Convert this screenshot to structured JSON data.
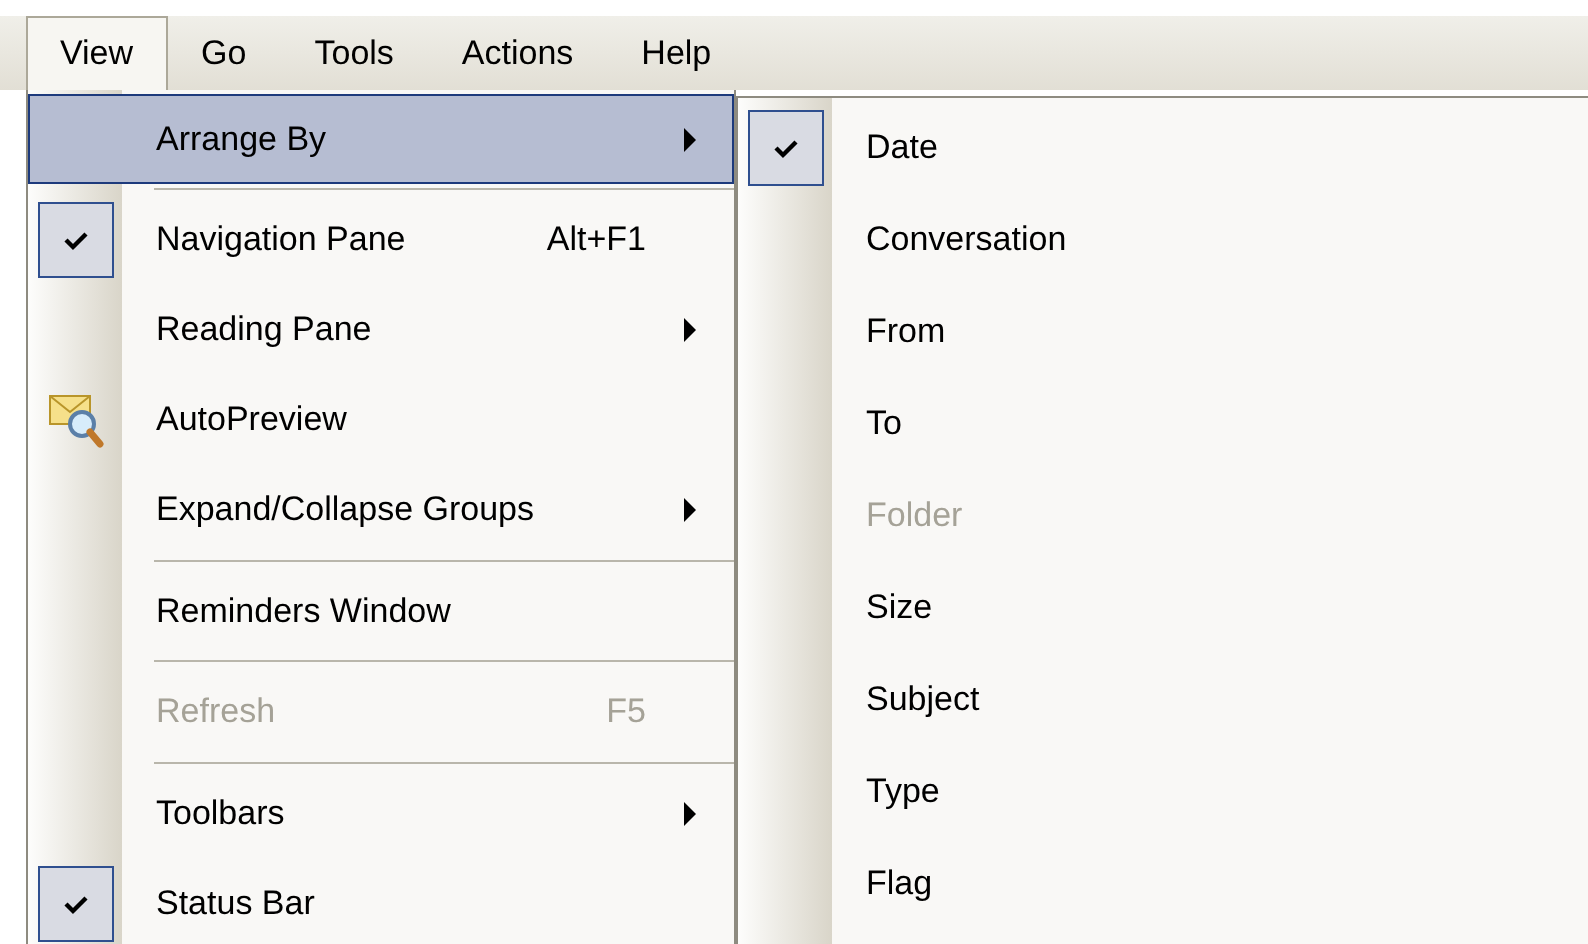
{
  "menu_bar": [
    {
      "label": "View",
      "selected": true
    },
    {
      "label": "Go",
      "selected": false
    },
    {
      "label": "Tools",
      "selected": false
    },
    {
      "label": "Actions",
      "selected": false
    },
    {
      "label": "Help",
      "selected": false
    }
  ],
  "view_menu": [
    {
      "kind": "submenu",
      "label": "Arrange By",
      "selected": true,
      "disabled": false
    },
    {
      "kind": "separator"
    },
    {
      "kind": "check",
      "label": "Navigation Pane",
      "shortcut": "Alt+F1",
      "checked": true,
      "selected": false,
      "disabled": false
    },
    {
      "kind": "submenu",
      "label": "Reading Pane",
      "selected": false,
      "disabled": false
    },
    {
      "kind": "icon",
      "label": "AutoPreview",
      "selected": false,
      "disabled": false
    },
    {
      "kind": "submenu",
      "label": "Expand/Collapse Groups",
      "selected": false,
      "disabled": false
    },
    {
      "kind": "separator"
    },
    {
      "kind": "command",
      "label": "Reminders Window",
      "selected": false,
      "disabled": false
    },
    {
      "kind": "separator"
    },
    {
      "kind": "command",
      "label": "Refresh",
      "shortcut": "F5",
      "selected": false,
      "disabled": true
    },
    {
      "kind": "separator"
    },
    {
      "kind": "submenu",
      "label": "Toolbars",
      "selected": false,
      "disabled": false
    },
    {
      "kind": "check",
      "label": "Status Bar",
      "checked": true,
      "selected": false,
      "disabled": false
    }
  ],
  "arrange_by_menu": [
    {
      "label": "Date",
      "checked": true,
      "disabled": false
    },
    {
      "label": "Conversation",
      "checked": false,
      "disabled": false
    },
    {
      "label": "From",
      "checked": false,
      "disabled": false
    },
    {
      "label": "To",
      "checked": false,
      "disabled": false
    },
    {
      "label": "Folder",
      "checked": false,
      "disabled": true
    },
    {
      "label": "Size",
      "checked": false,
      "disabled": false
    },
    {
      "label": "Subject",
      "checked": false,
      "disabled": false
    },
    {
      "label": "Type",
      "checked": false,
      "disabled": false
    },
    {
      "label": "Flag",
      "checked": false,
      "disabled": false
    }
  ]
}
